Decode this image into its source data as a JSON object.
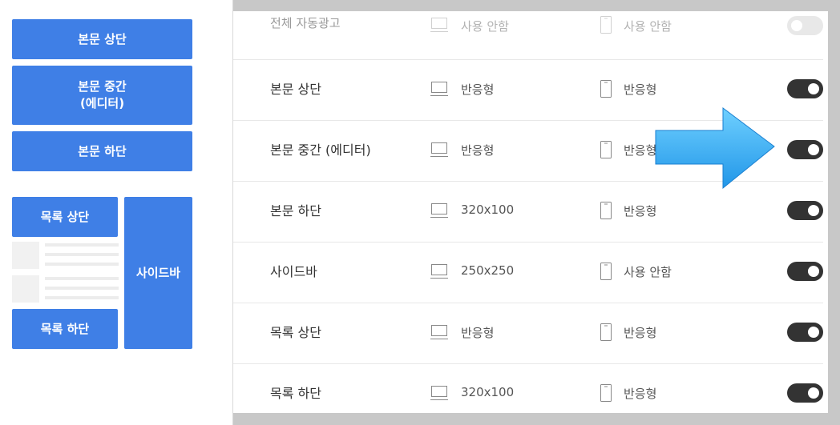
{
  "placement_preview": {
    "top_block": "본문 상단",
    "middle_block_line1": "본문 중간",
    "middle_block_line2": "(에디터)",
    "bottom_block": "본문 하단",
    "list_top_block": "목록 상단",
    "list_bottom_block": "목록 하단",
    "sidebar_block": "사이드바"
  },
  "ad_rows": [
    {
      "label": "전체 자동광고",
      "pc": "사용 안함",
      "mobile": "사용 안함",
      "enabled": false
    },
    {
      "label": "본문 상단",
      "pc": "반응형",
      "mobile": "반응형",
      "enabled": true
    },
    {
      "label": "본문 중간 (에디터)",
      "pc": "반응형",
      "mobile": "반응형",
      "enabled": true
    },
    {
      "label": "본문 하단",
      "pc": "320x100",
      "mobile": "반응형",
      "enabled": true
    },
    {
      "label": "사이드바",
      "pc": "250x250",
      "mobile": "사용 안함",
      "enabled": true
    },
    {
      "label": "목록 상단",
      "pc": "반응형",
      "mobile": "반응형",
      "enabled": true
    },
    {
      "label": "목록 하단",
      "pc": "320x100",
      "mobile": "반응형",
      "enabled": true
    }
  ],
  "colors": {
    "block_blue": "#3f7fe6",
    "toggle_on": "#333333",
    "toggle_off": "#e8e8e8",
    "arrow": "#3aaef2"
  },
  "icons": {
    "pc": "monitor-icon",
    "mobile": "mobile-phone-icon",
    "annotation": "right-arrow-icon"
  }
}
